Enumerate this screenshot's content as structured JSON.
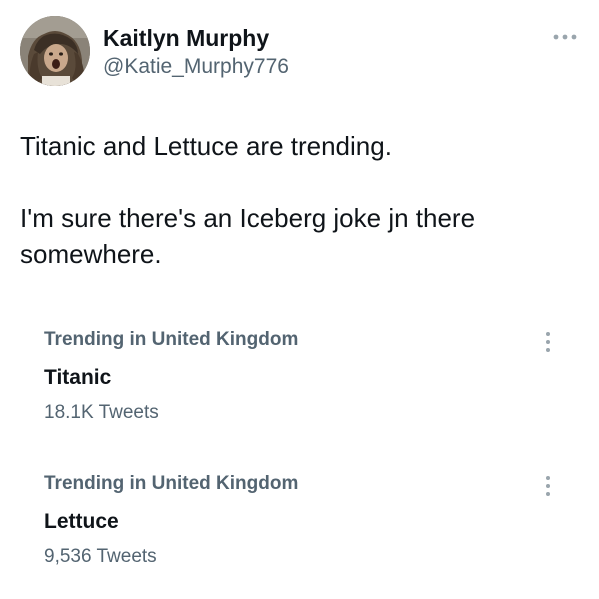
{
  "author": {
    "display_name": "Kaitlyn Murphy",
    "handle": "@Katie_Murphy776",
    "avatar_icon": "profile-photo"
  },
  "menu_icon": "more-horizontal-icon",
  "tweet": {
    "paragraphs": [
      "Titanic and Lettuce are trending.",
      "I'm sure there's an Iceberg joke jn there somewhere."
    ]
  },
  "trends": [
    {
      "context": "Trending in United Kingdom",
      "name": "Titanic",
      "count": "18.1K Tweets",
      "menu_icon": "more-vertical-icon"
    },
    {
      "context": "Trending in United Kingdom",
      "name": "Lettuce",
      "count": "9,536 Tweets",
      "menu_icon": "more-vertical-icon"
    }
  ],
  "colors": {
    "text_primary": "#0f1419",
    "text_secondary": "#536471",
    "icon_muted": "#9aa5ad",
    "background": "#ffffff"
  }
}
